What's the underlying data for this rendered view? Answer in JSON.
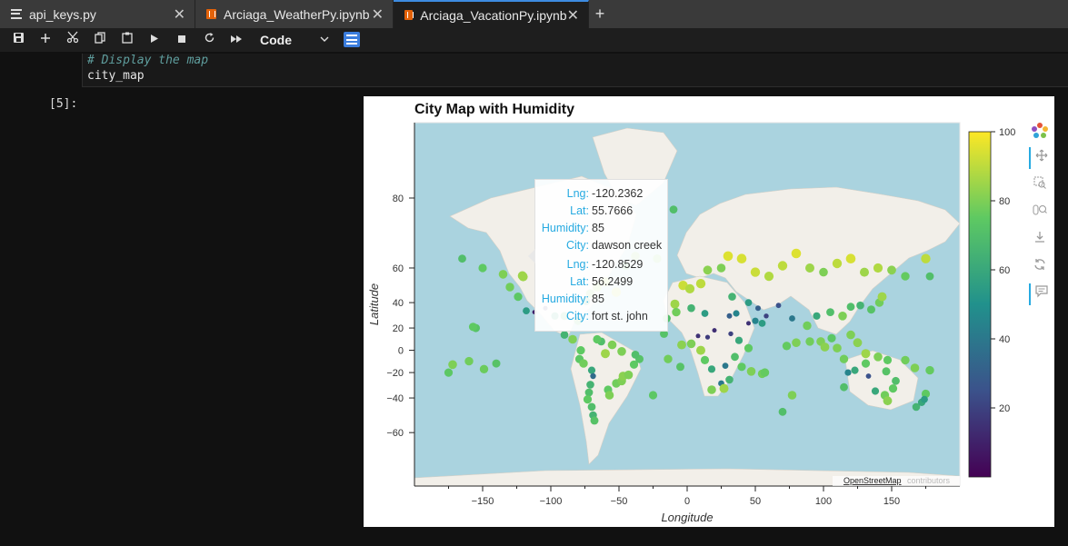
{
  "tabs": [
    {
      "label": "api_keys.py",
      "close": "✕",
      "icon": "file-icon"
    },
    {
      "label": "Arciaga_WeatherPy.ipynb",
      "close": "✕",
      "icon": "notebook-icon"
    },
    {
      "label": "Arciaga_VacationPy.ipynb",
      "close": "✕",
      "icon": "notebook-icon"
    }
  ],
  "tab_add": "+",
  "toolbar": {
    "icons": [
      "save-icon",
      "add-cell-icon",
      "cut-icon",
      "copy-icon",
      "paste-icon",
      "run-icon",
      "stop-icon",
      "restart-icon",
      "fast-forward-icon"
    ],
    "cell_type": "Code"
  },
  "cell": {
    "code_comment": "# Display the map",
    "code_line": "city_map",
    "prompt": "[5]:"
  },
  "figure": {
    "title": "City Map with Humidity",
    "xlabel": "Longitude",
    "ylabel": "Latitude",
    "attribution": "OpenStreetMap",
    "attribution_suffix": "contributors",
    "tooltip": [
      {
        "key": "Lng:",
        "value": "-120.2362"
      },
      {
        "key": "Lat:",
        "value": "55.7666"
      },
      {
        "key": "Humidity:",
        "value": "85"
      },
      {
        "key": "City:",
        "value": "dawson creek"
      },
      {
        "key": "Lng:",
        "value": "-120.8529"
      },
      {
        "key": "Lat:",
        "value": "56.2499"
      },
      {
        "key": "Humidity:",
        "value": "85"
      },
      {
        "key": "City:",
        "value": "fort st. john"
      }
    ]
  },
  "chart_data": {
    "type": "scatter",
    "title": "City Map with Humidity",
    "xlabel": "Longitude",
    "ylabel": "Latitude",
    "x_ticks": [
      -150,
      -100,
      -50,
      0,
      50,
      100,
      150
    ],
    "y_ticks": [
      -60,
      -40,
      -20,
      0,
      20,
      40,
      60,
      80
    ],
    "xlim": [
      -200,
      200
    ],
    "ylim": [
      -77,
      87
    ],
    "colorbar": {
      "ticks": [
        20,
        40,
        60,
        80,
        100
      ],
      "range": [
        0,
        100
      ],
      "colormap": "viridis"
    },
    "points": [
      {
        "lng": -120.2362,
        "lat": 55.7666,
        "humidity": 85,
        "city": "dawson creek"
      },
      {
        "lng": -120.8529,
        "lat": 56.2499,
        "humidity": 85,
        "city": "fort st. john"
      },
      {
        "lng": -135,
        "lat": 57,
        "humidity": 80
      },
      {
        "lng": -150,
        "lat": 60,
        "humidity": 75
      },
      {
        "lng": -165,
        "lat": 64,
        "humidity": 70
      },
      {
        "lng": -130,
        "lat": 50,
        "humidity": 78
      },
      {
        "lng": -124,
        "lat": 44,
        "humidity": 74
      },
      {
        "lng": -118,
        "lat": 34,
        "humidity": 55
      },
      {
        "lng": -112,
        "lat": 33,
        "humidity": 10
      },
      {
        "lng": -104,
        "lat": 36,
        "humidity": 15
      },
      {
        "lng": -97,
        "lat": 30,
        "humidity": 60
      },
      {
        "lng": -90,
        "lat": 30,
        "humidity": 70
      },
      {
        "lng": -80,
        "lat": 26,
        "humidity": 72
      },
      {
        "lng": -74,
        "lat": 41,
        "humidity": 65
      },
      {
        "lng": -71,
        "lat": 46,
        "humidity": 80
      },
      {
        "lng": -66,
        "lat": 50,
        "humidity": 85
      },
      {
        "lng": -60,
        "lat": 53,
        "humidity": 88
      },
      {
        "lng": -52,
        "lat": 47,
        "humidity": 90
      },
      {
        "lng": -45,
        "lat": 61,
        "humidity": 75
      },
      {
        "lng": -38,
        "lat": 65,
        "humidity": 80
      },
      {
        "lng": -22,
        "lat": 64,
        "humidity": 78
      },
      {
        "lng": -10,
        "lat": 78,
        "humidity": 70
      },
      {
        "lng": -155,
        "lat": 20,
        "humidity": 72
      },
      {
        "lng": -157,
        "lat": 21,
        "humidity": 75
      },
      {
        "lng": -149,
        "lat": -17,
        "humidity": 77
      },
      {
        "lng": -140,
        "lat": -12,
        "humidity": 72
      },
      {
        "lng": -160,
        "lat": -10,
        "humidity": 78
      },
      {
        "lng": -172,
        "lat": -13,
        "humidity": 80
      },
      {
        "lng": -175,
        "lat": -20,
        "humidity": 74
      },
      {
        "lng": -90,
        "lat": 14,
        "humidity": 65
      },
      {
        "lng": -84,
        "lat": 10,
        "humidity": 80
      },
      {
        "lng": -78,
        "lat": 0,
        "humidity": 75
      },
      {
        "lng": -79,
        "lat": -8,
        "humidity": 74
      },
      {
        "lng": -76,
        "lat": -12,
        "humidity": 78
      },
      {
        "lng": -70,
        "lat": -18,
        "humidity": 60
      },
      {
        "lng": -69,
        "lat": -23,
        "humidity": 35
      },
      {
        "lng": -71,
        "lat": -30,
        "humidity": 65
      },
      {
        "lng": -72,
        "lat": -36,
        "humidity": 70
      },
      {
        "lng": -73,
        "lat": -41,
        "humidity": 75
      },
      {
        "lng": -70,
        "lat": -46,
        "humidity": 70
      },
      {
        "lng": -69,
        "lat": -51,
        "humidity": 65
      },
      {
        "lng": -68,
        "lat": -54,
        "humidity": 72
      },
      {
        "lng": -58,
        "lat": -34,
        "humidity": 75
      },
      {
        "lng": -57,
        "lat": -38,
        "humidity": 80
      },
      {
        "lng": -52,
        "lat": -29,
        "humidity": 78
      },
      {
        "lng": -48,
        "lat": -27,
        "humidity": 80
      },
      {
        "lng": -47,
        "lat": -23,
        "humidity": 82
      },
      {
        "lng": -43,
        "lat": -22,
        "humidity": 80
      },
      {
        "lng": -39,
        "lat": -13,
        "humidity": 75
      },
      {
        "lng": -35,
        "lat": -8,
        "humidity": 72
      },
      {
        "lng": -38,
        "lat": -4,
        "humidity": 70
      },
      {
        "lng": -48,
        "lat": -1,
        "humidity": 80
      },
      {
        "lng": -60,
        "lat": -3,
        "humidity": 85
      },
      {
        "lng": -63,
        "lat": 8,
        "humidity": 70
      },
      {
        "lng": -66,
        "lat": 10,
        "humidity": 75
      },
      {
        "lng": -55,
        "lat": 5,
        "humidity": 80
      },
      {
        "lng": -25,
        "lat": -38,
        "humidity": 74
      },
      {
        "lng": -15,
        "lat": 28,
        "humidity": 70
      },
      {
        "lng": -17,
        "lat": 15,
        "humidity": 72
      },
      {
        "lng": -9,
        "lat": 39,
        "humidity": 85
      },
      {
        "lng": -3,
        "lat": 51,
        "humidity": 92
      },
      {
        "lng": 2,
        "lat": 49,
        "humidity": 88
      },
      {
        "lng": 10,
        "lat": 52,
        "humidity": 90
      },
      {
        "lng": 15,
        "lat": 59,
        "humidity": 82
      },
      {
        "lng": 25,
        "lat": 60,
        "humidity": 80
      },
      {
        "lng": 30,
        "lat": 65,
        "humidity": 95
      },
      {
        "lng": 40,
        "lat": 64,
        "humidity": 94
      },
      {
        "lng": 50,
        "lat": 58,
        "humidity": 92
      },
      {
        "lng": 60,
        "lat": 56,
        "humidity": 88
      },
      {
        "lng": 70,
        "lat": 61,
        "humidity": 90
      },
      {
        "lng": 80,
        "lat": 66,
        "humidity": 95
      },
      {
        "lng": 90,
        "lat": 60,
        "humidity": 85
      },
      {
        "lng": 100,
        "lat": 58,
        "humidity": 80
      },
      {
        "lng": 110,
        "lat": 62,
        "humidity": 90
      },
      {
        "lng": 120,
        "lat": 64,
        "humidity": 94
      },
      {
        "lng": 130,
        "lat": 58,
        "humidity": 85
      },
      {
        "lng": 140,
        "lat": 60,
        "humidity": 88
      },
      {
        "lng": 150,
        "lat": 59,
        "humidity": 82
      },
      {
        "lng": 160,
        "lat": 56,
        "humidity": 76
      },
      {
        "lng": 175,
        "lat": 64,
        "humidity": 90
      },
      {
        "lng": 178,
        "lat": 56,
        "humidity": 70
      },
      {
        "lng": 33,
        "lat": 44,
        "humidity": 65
      },
      {
        "lng": 45,
        "lat": 40,
        "humidity": 55
      },
      {
        "lng": 52,
        "lat": 36,
        "humidity": 30
      },
      {
        "lng": 58,
        "lat": 30,
        "humidity": 20
      },
      {
        "lng": 67,
        "lat": 38,
        "humidity": 25
      },
      {
        "lng": 77,
        "lat": 28,
        "humidity": 40
      },
      {
        "lng": 88,
        "lat": 22,
        "humidity": 78
      },
      {
        "lng": 95,
        "lat": 30,
        "humidity": 60
      },
      {
        "lng": 105,
        "lat": 33,
        "humidity": 70
      },
      {
        "lng": 114,
        "lat": 30,
        "humidity": 80
      },
      {
        "lng": 120,
        "lat": 37,
        "humidity": 70
      },
      {
        "lng": 127,
        "lat": 38,
        "humidity": 65
      },
      {
        "lng": 135,
        "lat": 35,
        "humidity": 72
      },
      {
        "lng": 141,
        "lat": 40,
        "humidity": 78
      },
      {
        "lng": 143,
        "lat": 44,
        "humidity": 85
      },
      {
        "lng": 36,
        "lat": 32,
        "humidity": 45
      },
      {
        "lng": 45,
        "lat": 24,
        "humidity": 15
      },
      {
        "lng": 50,
        "lat": 26,
        "humidity": 45
      },
      {
        "lng": 55,
        "lat": 24,
        "humidity": 55
      },
      {
        "lng": 31,
        "lat": 30,
        "humidity": 30
      },
      {
        "lng": 13,
        "lat": 32,
        "humidity": 55
      },
      {
        "lng": 3,
        "lat": 36,
        "humidity": 65
      },
      {
        "lng": -8,
        "lat": 33,
        "humidity": 78
      },
      {
        "lng": 8,
        "lat": 13,
        "humidity": 15
      },
      {
        "lng": 15,
        "lat": 12,
        "humidity": 18
      },
      {
        "lng": 20,
        "lat": 18,
        "humidity": 14
      },
      {
        "lng": 32,
        "lat": 15,
        "humidity": 20
      },
      {
        "lng": 38,
        "lat": 9,
        "humidity": 60
      },
      {
        "lng": 45,
        "lat": 2,
        "humidity": 75
      },
      {
        "lng": 3,
        "lat": 6,
        "humidity": 80
      },
      {
        "lng": -4,
        "lat": 5,
        "humidity": 82
      },
      {
        "lng": 10,
        "lat": 0,
        "humidity": 85
      },
      {
        "lng": 13,
        "lat": -9,
        "humidity": 75
      },
      {
        "lng": 18,
        "lat": -17,
        "humidity": 60
      },
      {
        "lng": 28,
        "lat": -14,
        "humidity": 40
      },
      {
        "lng": 35,
        "lat": -6,
        "humidity": 70
      },
      {
        "lng": 40,
        "lat": -15,
        "humidity": 75
      },
      {
        "lng": 31,
        "lat": -26,
        "humidity": 65
      },
      {
        "lng": 25,
        "lat": -29,
        "humidity": 40
      },
      {
        "lng": 18,
        "lat": -34,
        "humidity": 80
      },
      {
        "lng": 27,
        "lat": -33,
        "humidity": 85
      },
      {
        "lng": 47,
        "lat": -19,
        "humidity": 80
      },
      {
        "lng": 55,
        "lat": -21,
        "humidity": 78
      },
      {
        "lng": 57,
        "lat": -20,
        "humidity": 76
      },
      {
        "lng": 73,
        "lat": 4,
        "humidity": 76
      },
      {
        "lng": 80,
        "lat": 7,
        "humidity": 80
      },
      {
        "lng": 90,
        "lat": 8,
        "humidity": 78
      },
      {
        "lng": 98,
        "lat": 8,
        "humidity": 80
      },
      {
        "lng": 101,
        "lat": 3,
        "humidity": 82
      },
      {
        "lng": 106,
        "lat": 11,
        "humidity": 74
      },
      {
        "lng": 110,
        "lat": 2,
        "humidity": 80
      },
      {
        "lng": 115,
        "lat": -8,
        "humidity": 78
      },
      {
        "lng": 120,
        "lat": 14,
        "humidity": 80
      },
      {
        "lng": 125,
        "lat": 7,
        "humidity": 82
      },
      {
        "lng": 131,
        "lat": -3,
        "humidity": 85
      },
      {
        "lng": 140,
        "lat": -6,
        "humidity": 80
      },
      {
        "lng": 147,
        "lat": -9,
        "humidity": 75
      },
      {
        "lng": 160,
        "lat": -9,
        "humidity": 78
      },
      {
        "lng": 167,
        "lat": -16,
        "humidity": 80
      },
      {
        "lng": 178,
        "lat": -18,
        "humidity": 76
      },
      {
        "lng": 115,
        "lat": -32,
        "humidity": 70
      },
      {
        "lng": 118,
        "lat": -20,
        "humidity": 45
      },
      {
        "lng": 123,
        "lat": -18,
        "humidity": 60
      },
      {
        "lng": 131,
        "lat": -12,
        "humidity": 75
      },
      {
        "lng": 133,
        "lat": -23,
        "humidity": 25
      },
      {
        "lng": 138,
        "lat": -35,
        "humidity": 60
      },
      {
        "lng": 145,
        "lat": -38,
        "humidity": 78
      },
      {
        "lng": 147,
        "lat": -42,
        "humidity": 82
      },
      {
        "lng": 151,
        "lat": -33,
        "humidity": 75
      },
      {
        "lng": 153,
        "lat": -27,
        "humidity": 70
      },
      {
        "lng": 146,
        "lat": -19,
        "humidity": 72
      },
      {
        "lng": 168,
        "lat": -46,
        "humidity": 65
      },
      {
        "lng": 172,
        "lat": -43,
        "humidity": 60
      },
      {
        "lng": 175,
        "lat": -37,
        "humidity": 75
      },
      {
        "lng": 174,
        "lat": -41,
        "humidity": 55
      },
      {
        "lng": 70,
        "lat": -49,
        "humidity": 70
      },
      {
        "lng": 77,
        "lat": -38,
        "humidity": 80
      },
      {
        "lng": -5,
        "lat": -15,
        "humidity": 72
      },
      {
        "lng": -14,
        "lat": -8,
        "humidity": 78
      }
    ]
  }
}
